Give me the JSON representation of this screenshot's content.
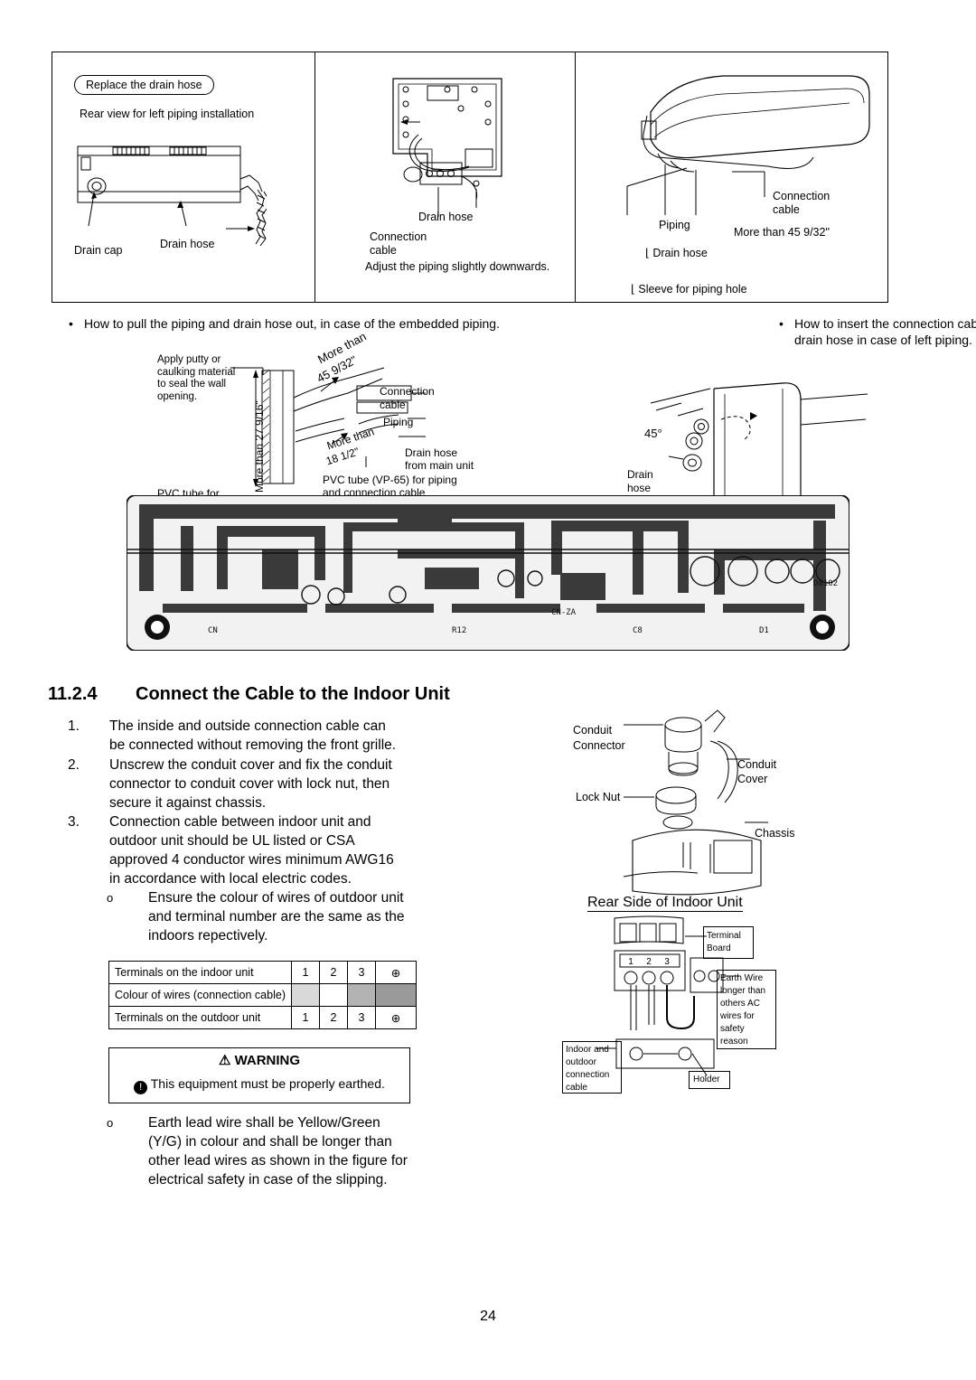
{
  "figure_top": {
    "panel1": {
      "pill": "Replace the drain hose",
      "caption": "Rear view for left piping installation",
      "labels": [
        "Drain cap",
        "Drain hose"
      ]
    },
    "panel2": {
      "labels": [
        "Drain hose",
        "Connection",
        "cable"
      ],
      "caption": "Adjust the piping slightly downwards."
    },
    "panel3": {
      "labels": [
        "Connection",
        "cable",
        "Piping",
        "Drain hose",
        "Sleeve for piping hole"
      ],
      "dim": "More than 45 9/32\""
    }
  },
  "notes": {
    "left": "How to pull the piping and drain hose out, in case of the embedded piping.",
    "right_line1": "How to insert the connection cable and",
    "right_line2": "drain hose in case of left piping."
  },
  "figure_mid": {
    "left": {
      "putty": [
        "Apply putty or",
        "caulking material",
        "to seal the wall",
        "opening."
      ],
      "more_than_45": [
        "More than",
        "45 9/32\""
      ],
      "more_than_18": [
        "More than",
        "18 1/2\""
      ],
      "more_than_27": "More than 27 9/16\"",
      "connection_cable": [
        "Connection",
        "cable"
      ],
      "piping": "Piping",
      "drain_hose": [
        "Drain hose",
        "from main unit"
      ],
      "pvc_note": [
        "PVC tube (VP-65) for piping",
        "and connection cable"
      ],
      "pvc_left": "PVC tube for"
    },
    "right": {
      "angle": "45°",
      "drain_hose": [
        "Drain",
        "hose"
      ]
    }
  },
  "section": {
    "number": "11.2.4",
    "title": "Connect the Cable to the Indoor Unit"
  },
  "steps": [
    {
      "num": "1.",
      "lines": [
        "The inside and outside connection cable can",
        "be connected without removing the front grille."
      ]
    },
    {
      "num": "2.",
      "lines": [
        "Unscrew the conduit cover and fix the conduit",
        "connector to conduit cover with lock nut, then",
        "secure it against chassis."
      ]
    },
    {
      "num": "3.",
      "lines": [
        "Connection cable between indoor unit and",
        "outdoor unit should be UL listed or CSA",
        "approved 4 conductor wires minimum AWG16",
        "in accordance with local electric codes."
      ]
    }
  ],
  "bullets": [
    {
      "marker": "o",
      "lines": [
        "Ensure the colour of wires of outdoor unit",
        "and terminal number are the same as the",
        "indoors repectively."
      ]
    },
    {
      "marker": "o",
      "lines": [
        "Earth lead wire shall be Yellow/Green",
        "(Y/G) in colour and shall be longer than",
        "other lead wires as shown in the figure for",
        "electrical safety in case of the slipping."
      ]
    }
  ],
  "table": {
    "rows": [
      {
        "label": "Terminals on the indoor unit",
        "cells": [
          "1",
          "2",
          "3"
        ],
        "ground": "⊕"
      },
      {
        "label": "Colour of wires (connection cable)",
        "cells": [
          "",
          "",
          ""
        ],
        "ground": ""
      },
      {
        "label": "Terminals on the outdoor unit",
        "cells": [
          "1",
          "2",
          "3"
        ],
        "ground": "⊕"
      }
    ],
    "swatch_colors": [
      "#d9d9d9",
      "#ffffff",
      "#b3b3b3",
      "#9a9a9a"
    ]
  },
  "warning": {
    "title": "WARNING",
    "text": "This equipment must be properly earthed."
  },
  "right_figure": {
    "conduit_connector": [
      "Conduit",
      "Connector"
    ],
    "conduit_cover": [
      "Conduit",
      "Cover"
    ],
    "lock_nut": "Lock Nut",
    "chassis": "Chassis",
    "caption": "Rear Side of Indoor Unit",
    "terminal_board": [
      "Terminal",
      "Board"
    ],
    "terminal_numbers": [
      "1",
      "2",
      "3"
    ],
    "earth_wire": [
      "Earth Wire",
      "longer than",
      "others AC",
      "wires for",
      "safety",
      "reason"
    ],
    "indoor_outdoor": [
      "Indoor and",
      "outdoor",
      "connection",
      "cable"
    ],
    "holder": "Holder"
  },
  "page_number": "24"
}
